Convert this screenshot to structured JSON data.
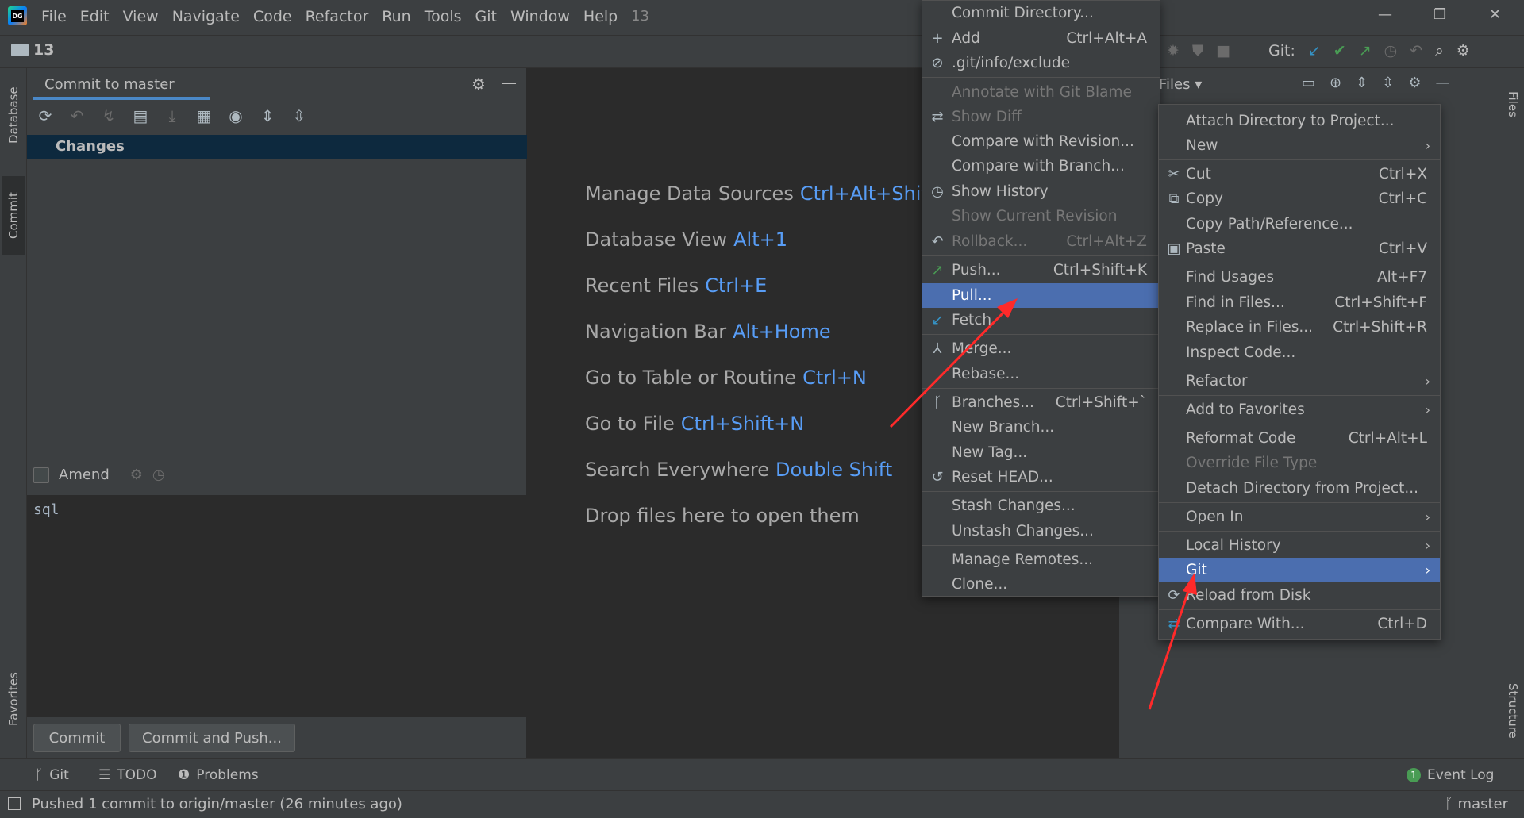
{
  "menubar": {
    "items": [
      "File",
      "Edit",
      "View",
      "Navigate",
      "Code",
      "Refactor",
      "Run",
      "Tools",
      "Git",
      "Window",
      "Help"
    ],
    "project_title": "13",
    "logo_text": "DG"
  },
  "navbar": {
    "project": "13",
    "git_label": "Git:",
    "files_label": "Files"
  },
  "left_strip": {
    "database": "Database",
    "commit": "Commit",
    "favorites": "Favorites"
  },
  "right_strip": {
    "files": "Files",
    "structure": "Structure"
  },
  "commit_panel": {
    "title": "Commit to master",
    "changes": "Changes",
    "amend": "Amend",
    "message": "sql",
    "commit_button": "Commit",
    "commit_push_button": "Commit and Push..."
  },
  "editor_hints": [
    {
      "label": "Manage Data Sources",
      "key": "Ctrl+Alt+Shift+S"
    },
    {
      "label": "Database View",
      "key": "Alt+1"
    },
    {
      "label": "Recent Files",
      "key": "Ctrl+E"
    },
    {
      "label": "Navigation Bar",
      "key": "Alt+Home"
    },
    {
      "label": "Go to Table or Routine",
      "key": "Ctrl+N"
    },
    {
      "label": "Go to File",
      "key": "Ctrl+Shift+N"
    },
    {
      "label": "Search Everywhere",
      "key": "Double Shift"
    },
    {
      "label": "Drop files here to open them",
      "key": ""
    }
  ],
  "git_menu": [
    {
      "label": "Commit Directory...",
      "shortcut": "",
      "icon": ""
    },
    {
      "label": "Add",
      "shortcut": "Ctrl+Alt+A",
      "icon": "+"
    },
    {
      "label": ".git/info/exclude",
      "shortcut": "",
      "icon": "⊘"
    },
    {
      "label": "Annotate with Git Blame",
      "shortcut": "",
      "icon": ""
    },
    {
      "label": "Show Diff",
      "shortcut": "",
      "icon": "⇄"
    },
    {
      "label": "Compare with Revision...",
      "shortcut": "",
      "icon": ""
    },
    {
      "label": "Compare with Branch...",
      "shortcut": "",
      "icon": ""
    },
    {
      "label": "Show History",
      "shortcut": "",
      "icon": "◷"
    },
    {
      "label": "Show Current Revision",
      "shortcut": "",
      "icon": ""
    },
    {
      "label": "Rollback...",
      "shortcut": "Ctrl+Alt+Z",
      "icon": "↶"
    },
    {
      "label": "Push...",
      "shortcut": "Ctrl+Shift+K",
      "icon": "↗"
    },
    {
      "label": "Pull...",
      "shortcut": "",
      "icon": ""
    },
    {
      "label": "Fetch",
      "shortcut": "",
      "icon": "↙"
    },
    {
      "label": "Merge...",
      "shortcut": "",
      "icon": "⅄"
    },
    {
      "label": "Rebase...",
      "shortcut": "",
      "icon": ""
    },
    {
      "label": "Branches...",
      "shortcut": "Ctrl+Shift+`",
      "icon": "ᚴ"
    },
    {
      "label": "New Branch...",
      "shortcut": "",
      "icon": ""
    },
    {
      "label": "New Tag...",
      "shortcut": "",
      "icon": ""
    },
    {
      "label": "Reset HEAD...",
      "shortcut": "",
      "icon": "↺"
    },
    {
      "label": "Stash Changes...",
      "shortcut": "",
      "icon": ""
    },
    {
      "label": "Unstash Changes...",
      "shortcut": "",
      "icon": ""
    },
    {
      "label": "Manage Remotes...",
      "shortcut": "",
      "icon": ""
    },
    {
      "label": "Clone...",
      "shortcut": "",
      "icon": ""
    }
  ],
  "file_menu": [
    {
      "label": "Attach Directory to Project...",
      "shortcut": ""
    },
    {
      "label": "New",
      "shortcut": ""
    },
    {
      "label": "Cut",
      "shortcut": "Ctrl+X"
    },
    {
      "label": "Copy",
      "shortcut": "Ctrl+C"
    },
    {
      "label": "Copy Path/Reference...",
      "shortcut": ""
    },
    {
      "label": "Paste",
      "shortcut": "Ctrl+V"
    },
    {
      "label": "Find Usages",
      "shortcut": "Alt+F7"
    },
    {
      "label": "Find in Files...",
      "shortcut": "Ctrl+Shift+F"
    },
    {
      "label": "Replace in Files...",
      "shortcut": "Ctrl+Shift+R"
    },
    {
      "label": "Inspect Code...",
      "shortcut": ""
    },
    {
      "label": "Refactor",
      "shortcut": ""
    },
    {
      "label": "Add to Favorites",
      "shortcut": ""
    },
    {
      "label": "Reformat Code",
      "shortcut": "Ctrl+Alt+L"
    },
    {
      "label": "Override File Type",
      "shortcut": ""
    },
    {
      "label": "Detach Directory from Project...",
      "shortcut": ""
    },
    {
      "label": "Open In",
      "shortcut": ""
    },
    {
      "label": "Local History",
      "shortcut": ""
    },
    {
      "label": "Git",
      "shortcut": ""
    },
    {
      "label": "Reload from Disk",
      "shortcut": ""
    },
    {
      "label": "Compare With...",
      "shortcut": "Ctrl+D"
    }
  ],
  "bottom_tools": {
    "git": "Git",
    "todo": "TODO",
    "problems": "Problems",
    "event_log": "Event Log",
    "event_count": "1"
  },
  "statusbar": {
    "message": "Pushed 1 commit to origin/master (26 minutes ago)",
    "branch": "master"
  },
  "colors": {
    "selection": "#4b6eaf",
    "shortcut_blue": "#589df6",
    "annotation_red": "#ff2a2a"
  }
}
